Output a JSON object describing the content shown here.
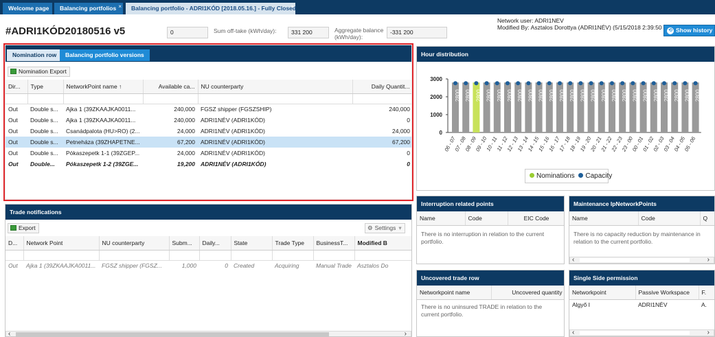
{
  "tabs": [
    {
      "label": "Welcome page"
    },
    {
      "label": "Balancing portfolios",
      "close": "×"
    },
    {
      "label": "Balancing portfolio - ADRI1KÓD [2018.05.16.] - Fully Closed",
      "close": "×"
    }
  ],
  "header": {
    "title": "#ADRI1KÓD20180516 v5",
    "field1": "0",
    "offtake_label": "Sum off-take (kWh/day):",
    "offtake_value": "331 200",
    "aggregate_label": "Aggregate balance (kWh/day):",
    "aggregate_value": "-331 200",
    "network_user": "Network user: ADRI1NEV",
    "modified_by": "Modified By: Asztalos Dorottya (ADRI1NÉV) (5/15/2018 2:39:50 PM)",
    "show_history": "Show history"
  },
  "nomination": {
    "tab_active": "Nomination row",
    "tab_other": "Balancing portfolio versions",
    "export_label": "Nomination Export",
    "columns": [
      "Dir...",
      "Type",
      "NetworkPoint name ↑",
      "Available ca...",
      "NU counterparty",
      "Daily Quantit..."
    ],
    "rows": [
      [
        "Out",
        "Double s...",
        "Ajka 1 (39ZKAAJKA0011...",
        "240,000",
        "FGSZ shipper (FGSZSHIP)",
        "240,000"
      ],
      [
        "Out",
        "Double s...",
        "Ajka 1 (39ZKAAJKA0011...",
        "240,000",
        "ADRI1NÉV (ADRI1KÓD)",
        "0"
      ],
      [
        "Out",
        "Double s...",
        "Csanádpalota (HU>RO) (2...",
        "24,000",
        "ADRI1NÉV (ADRI1KÓD)",
        "24,000"
      ],
      [
        "Out",
        "Double s...",
        "Petneháza (39ZHAPETNE...",
        "67,200",
        "ADRI1NÉV (ADRI1KÓD)",
        "67,200"
      ],
      [
        "Out",
        "Double s...",
        "Pókaszepetk 1-1 (39ZGEP...",
        "24,000",
        "ADRI1NÉV (ADRI1KÓD)",
        "0"
      ],
      [
        "Out",
        "Double...",
        "Pókaszepetk 1-2 (39ZGE...",
        "19,200",
        "ADRI1NÉV (ADRI1KÓD)",
        "0"
      ]
    ]
  },
  "trade": {
    "title": "Trade notifications",
    "export_label": "Export",
    "settings_label": "Settings",
    "columns": [
      "D...",
      "Network Point",
      "NU counterparty",
      "Subm...",
      "Daily...",
      "State",
      "Trade Type",
      "BusinessT...",
      "Modified B"
    ],
    "rows": [
      [
        "Out",
        "Ajka 1 (39ZKAAJKA0011...",
        "FGSZ shipper (FGSZ...",
        "1,000",
        "0",
        "Created",
        "Acquiring",
        "Manual Trade",
        "Asztalos Do"
      ]
    ]
  },
  "hour": {
    "title": "Hour distribution",
    "legend_nominations": "Nominations",
    "legend_capacity": "Capacity"
  },
  "chart_data": {
    "type": "bar",
    "categories": [
      "06 - 07",
      "07 - 08",
      "08 - 09",
      "09 - 10",
      "10 - 11",
      "11 - 12",
      "12 - 13",
      "13 - 14",
      "14 - 15",
      "15 - 16",
      "16 - 17",
      "17 - 18",
      "18 - 19",
      "19 - 20",
      "20 - 21",
      "21 - 22",
      "22 - 23",
      "23 - 00",
      "00 - 01",
      "01 - 02",
      "02 - 03",
      "03 - 04",
      "04 - 05",
      "05 - 06"
    ],
    "series": [
      {
        "name": "Nominations",
        "values": [
          2800,
          2800,
          2800,
          2800,
          2800,
          2800,
          2800,
          2800,
          2800,
          2800,
          2800,
          2800,
          2800,
          2800,
          2800,
          2800,
          2800,
          2800,
          2800,
          2800,
          2800,
          2800,
          2800,
          2800
        ]
      },
      {
        "name": "Capacity",
        "values": [
          2800,
          2800,
          2800,
          2800,
          2800,
          2800,
          2800,
          2800,
          2800,
          2800,
          2800,
          2800,
          2800,
          2800,
          2800,
          2800,
          2800,
          2800,
          2800,
          2800,
          2800,
          2800,
          2800,
          2800
        ]
      }
    ],
    "bar_labels": [
      "2800",
      "2800",
      "2800",
      "2800",
      "2800",
      "2800",
      "2800",
      "2800",
      "2800",
      "2800",
      "2800",
      "2800",
      "2800",
      "2800",
      "2800",
      "2800",
      "2800",
      "2800",
      "2800",
      "2800",
      "2800",
      "2800",
      "2800",
      "2800"
    ],
    "highlight_index": 2,
    "yticks": [
      0,
      1000,
      2000,
      3000
    ],
    "ylim": [
      0,
      3000
    ],
    "legend_position": "bottom",
    "colors": {
      "bar": "#9a9a9a",
      "highlight": "#c8e25a",
      "capacity": "#1f5f99"
    }
  },
  "interruption": {
    "title": "Interruption related points",
    "columns": [
      "Name",
      "Code",
      "EIC Code"
    ],
    "empty": "There is no interruption in relation to the current portfolio."
  },
  "maintenance": {
    "title": "Maintenance IpNetworkPoints",
    "columns": [
      "Name",
      "Code",
      "Q"
    ],
    "empty": "There is no capacity reduction by maintenance in relation to the current portfolio."
  },
  "uncovered": {
    "title": "Uncovered trade row",
    "columns": [
      "Networkpoint name",
      "Uncovered quantity"
    ],
    "empty": "There is no uninsured TRADE in relation to the current portfolio."
  },
  "single_side": {
    "title": "Single Side permission",
    "columns": [
      "Networkpoint",
      "Passive Workspace",
      "F."
    ],
    "row": [
      "Algyő I",
      "ADRI1NÉV",
      "A."
    ]
  }
}
